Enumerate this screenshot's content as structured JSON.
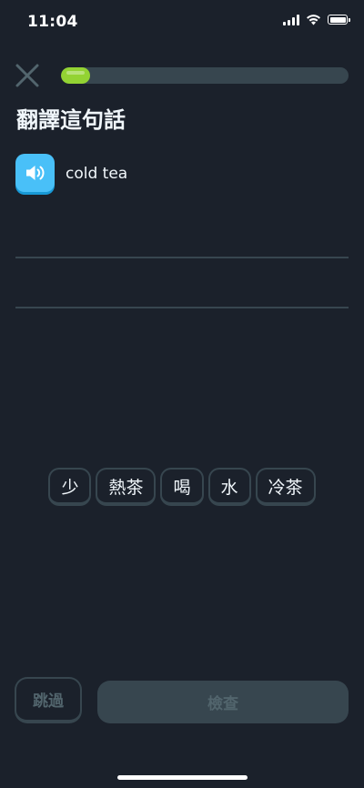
{
  "status_bar": {
    "time": "11:04"
  },
  "header": {
    "progress": 0.1
  },
  "prompt": {
    "title": "翻譯這句話",
    "phrase": "cold tea"
  },
  "word_bank": {
    "tiles": [
      "少",
      "熱茶",
      "喝",
      "水",
      "冷茶"
    ]
  },
  "footer": {
    "skip_label": "跳過",
    "check_label": "檢查"
  },
  "colors": {
    "background": "#1b212b",
    "progress_fill": "#93d333",
    "speaker": "#49c0f8",
    "tile_border": "#37464f"
  },
  "icons": {
    "close": "close-icon",
    "speaker": "speaker-icon",
    "signal": "signal-icon",
    "wifi": "wifi-icon",
    "battery": "battery-icon"
  }
}
